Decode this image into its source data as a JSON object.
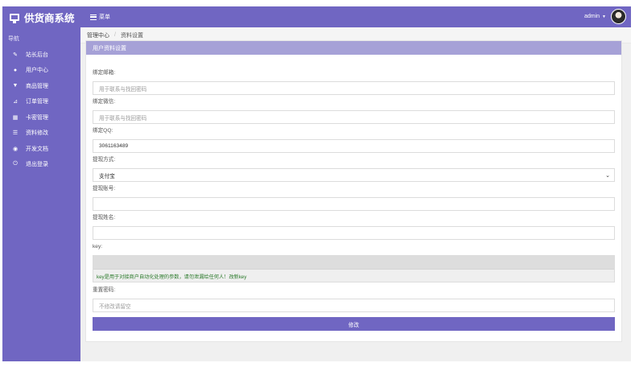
{
  "brand": {
    "title": "供货商系统",
    "icon": "monitor-icon"
  },
  "topbar": {
    "menu_label": "菜单",
    "user_name": "admin"
  },
  "sidebar": {
    "heading": "导航",
    "items": [
      {
        "label": "站长后台",
        "icon": "wrench-icon"
      },
      {
        "label": "用户中心",
        "icon": "user-icon"
      },
      {
        "label": "商品管理",
        "icon": "cart-icon"
      },
      {
        "label": "订单管理",
        "icon": "chart-icon"
      },
      {
        "label": "卡密管理",
        "icon": "grid-icon"
      },
      {
        "label": "资料修改",
        "icon": "list-icon"
      },
      {
        "label": "开发文档",
        "icon": "eye-icon"
      },
      {
        "label": "退出登录",
        "icon": "power-icon"
      }
    ]
  },
  "breadcrumb": {
    "home": "管理中心",
    "current": "资料设置"
  },
  "panel": {
    "title": "用户资料设置",
    "fields": {
      "email_label": "绑定邮箱:",
      "email_placeholder": "用于联系与找回密码",
      "wechat_label": "绑定微信:",
      "wechat_placeholder": "用于联系与找回密码",
      "qq_label": "绑定QQ:",
      "qq_value": "3061163489",
      "withdraw_method_label": "提现方式:",
      "withdraw_method_value": "支付宝",
      "withdraw_account_label": "提现账号:",
      "withdraw_account_value": "",
      "withdraw_name_label": "提现姓名:",
      "withdraw_name_value": "",
      "key_label": "key:",
      "key_hint": "key是用于对接商户自动化处理的参数，请勿泄漏给任何人！改新key",
      "password_label": "重置密码:",
      "password_placeholder": "不修改请留空"
    },
    "submit_label": "修改"
  },
  "colors": {
    "accent": "#7066c2",
    "panel_header": "#a6a1d7"
  }
}
